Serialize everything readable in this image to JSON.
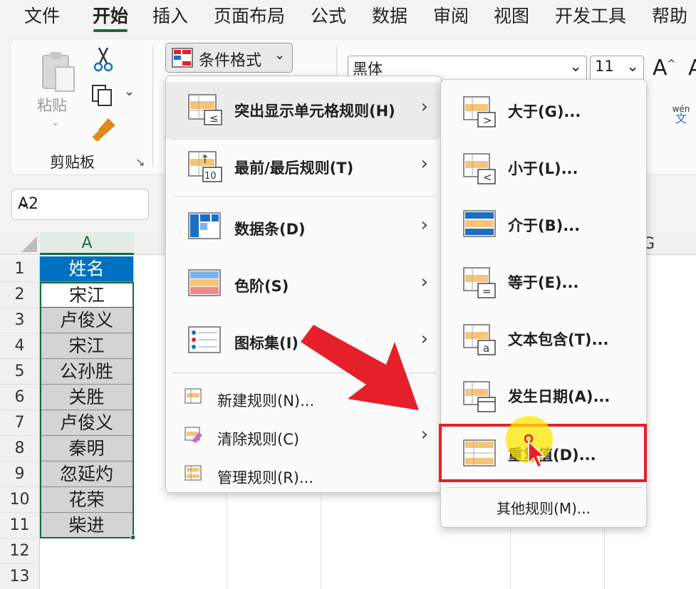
{
  "ribbon_tabs": [
    "文件",
    "开始",
    "插入",
    "页面布局",
    "公式",
    "数据",
    "审阅",
    "视图",
    "开发工具",
    "帮助"
  ],
  "clipboard": {
    "paste_label": "粘贴",
    "group_label": "剪贴板"
  },
  "conditional_format": {
    "button_label": "条件格式"
  },
  "font": {
    "name": "黑体",
    "size": "11",
    "grow_label": "A",
    "phonetic_label": "wén",
    "phonetic_char": "文"
  },
  "name_box": "A2",
  "grid": {
    "columns": [
      "A",
      "G"
    ],
    "rows": [
      "1",
      "2",
      "3",
      "4",
      "5",
      "6",
      "7",
      "8",
      "9",
      "10",
      "11",
      "12",
      "13"
    ],
    "cells": [
      "姓名",
      "宋江",
      "卢俊义",
      "宋江",
      "公孙胜",
      "关胜",
      "卢俊义",
      "秦明",
      "忽延灼",
      "花荣",
      "柴进",
      "",
      ""
    ]
  },
  "menu_main": {
    "items": [
      {
        "label": "突出显示单元格规则(H)",
        "icon": "highlight-cells-icon",
        "submenu": true
      },
      {
        "label": "最前/最后规则(T)",
        "icon": "top-bottom-icon",
        "submenu": true
      },
      {
        "label": "数据条(D)",
        "icon": "data-bars-icon",
        "submenu": true
      },
      {
        "label": "色阶(S)",
        "icon": "color-scales-icon",
        "submenu": true
      },
      {
        "label": "图标集(I)",
        "icon": "icon-sets-icon",
        "submenu": true
      }
    ],
    "small_items": [
      {
        "label": "新建规则(N)...",
        "icon": "new-rule-icon",
        "submenu": false
      },
      {
        "label": "清除规则(C)",
        "icon": "clear-rules-icon",
        "submenu": true
      },
      {
        "label": "管理规则(R)...",
        "icon": "manage-rules-icon",
        "submenu": false
      }
    ]
  },
  "menu_sub": {
    "items": [
      {
        "label": "大于(G)...",
        "icon": "greater-than-icon"
      },
      {
        "label": "小于(L)...",
        "icon": "less-than-icon"
      },
      {
        "label": "介于(B)...",
        "icon": "between-icon"
      },
      {
        "label": "等于(E)...",
        "icon": "equal-to-icon"
      },
      {
        "label": "文本包含(T)...",
        "icon": "text-contains-icon"
      },
      {
        "label": "发生日期(A)...",
        "icon": "date-occurring-icon"
      },
      {
        "label": "重复值(D)...",
        "icon": "duplicate-values-icon"
      }
    ],
    "more_label": "其他规则(M)..."
  },
  "colors": {
    "accent_green": "#166c3b",
    "header_blue": "#0070c0",
    "highlight_red": "#e5202a",
    "cursor_yellow": "#ffe600"
  }
}
